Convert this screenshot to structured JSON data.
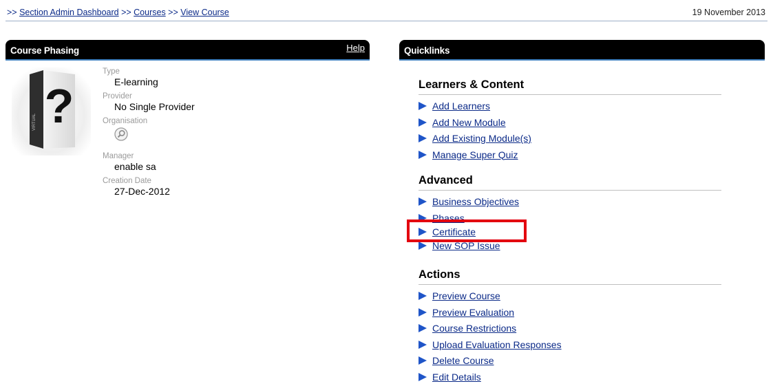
{
  "breadcrumb": {
    "prefix": ">> ",
    "sep": " >> ",
    "items": [
      "Section Admin Dashboard",
      "Courses",
      "View Course"
    ]
  },
  "date": "19 November 2013",
  "left_panel": {
    "title": "Course Phasing",
    "help": "Help",
    "fields": {
      "type_label": "Type",
      "type_value": "E-learning",
      "provider_label": "Provider",
      "provider_value": "No Single Provider",
      "org_label": "Organisation",
      "manager_label": "Manager",
      "manager_value": "enable sa",
      "created_label": "Creation Date",
      "created_value": "27-Dec-2012"
    },
    "icons": {
      "course_image": "unknown-course-box-icon",
      "organisation": "search-magnifier-icon"
    }
  },
  "quicklinks": {
    "title": "Quicklinks",
    "sections": [
      {
        "heading": "Learners & Content",
        "links": [
          "Add Learners",
          "Add New Module",
          "Add Existing Module(s)",
          "Manage Super Quiz"
        ]
      },
      {
        "heading": "Advanced",
        "links": [
          "Business Objectives",
          "Phases",
          "Certificate",
          "New SOP Issue"
        ]
      },
      {
        "heading": "Actions",
        "links": [
          "Preview Course",
          "Preview Evaluation",
          "Course Restrictions",
          "Upload Evaluation Responses",
          "Delete Course",
          "Edit Details"
        ]
      }
    ]
  },
  "colors": {
    "link": "#0b2a88",
    "bullet": "#1f55c8",
    "header_bg": "#000000",
    "highlight": "#e3000f"
  }
}
